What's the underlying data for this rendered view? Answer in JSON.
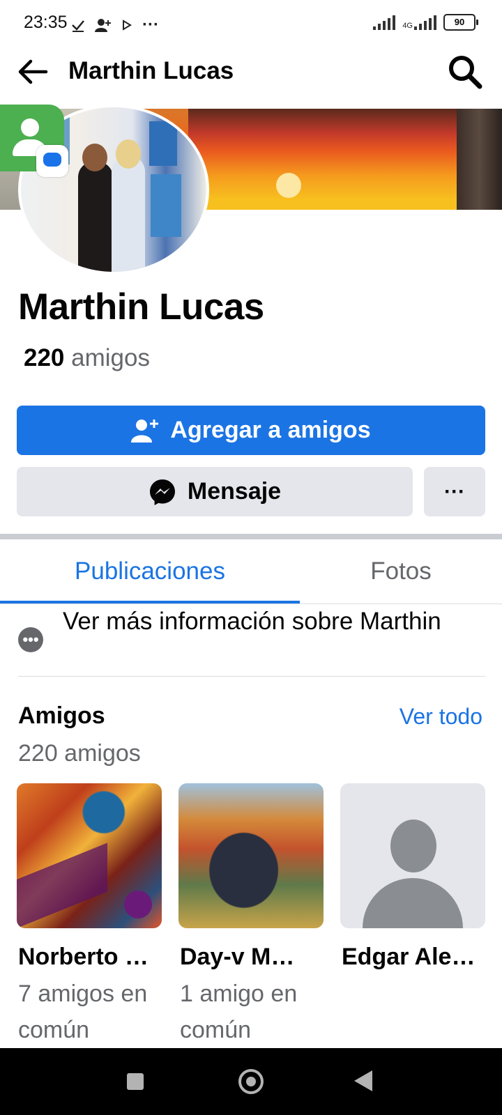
{
  "status_bar": {
    "time": "23:35",
    "dots": "···",
    "network": "4G",
    "battery": "90"
  },
  "header": {
    "title": "Marthin Lucas",
    "back_icon": "arrow-left-icon",
    "search_icon": "search-icon"
  },
  "profile": {
    "name": "Marthin Lucas",
    "friends_number": "220",
    "friends_word": "amigos"
  },
  "actions": {
    "add_friend": "Agregar a amigos",
    "message": "Mensaje",
    "more": "···"
  },
  "tabs": [
    {
      "label": "Publicaciones",
      "active": true
    },
    {
      "label": "Fotos",
      "active": false
    }
  ],
  "info": {
    "text": "Ver más información sobre Marthin"
  },
  "friends_section": {
    "title": "Amigos",
    "see_all": "Ver todo",
    "count_text": "220 amigos",
    "items": [
      {
        "name": "Norberto …",
        "mutual": "7 amigos en común"
      },
      {
        "name": "Day-v M…",
        "mutual": "1 amigo en común"
      },
      {
        "name": "Edgar Ale…",
        "mutual": ""
      }
    ]
  },
  "colors": {
    "accent": "#1b74e4",
    "secondary_button": "#e4e6eb",
    "muted_text": "#65676b"
  }
}
